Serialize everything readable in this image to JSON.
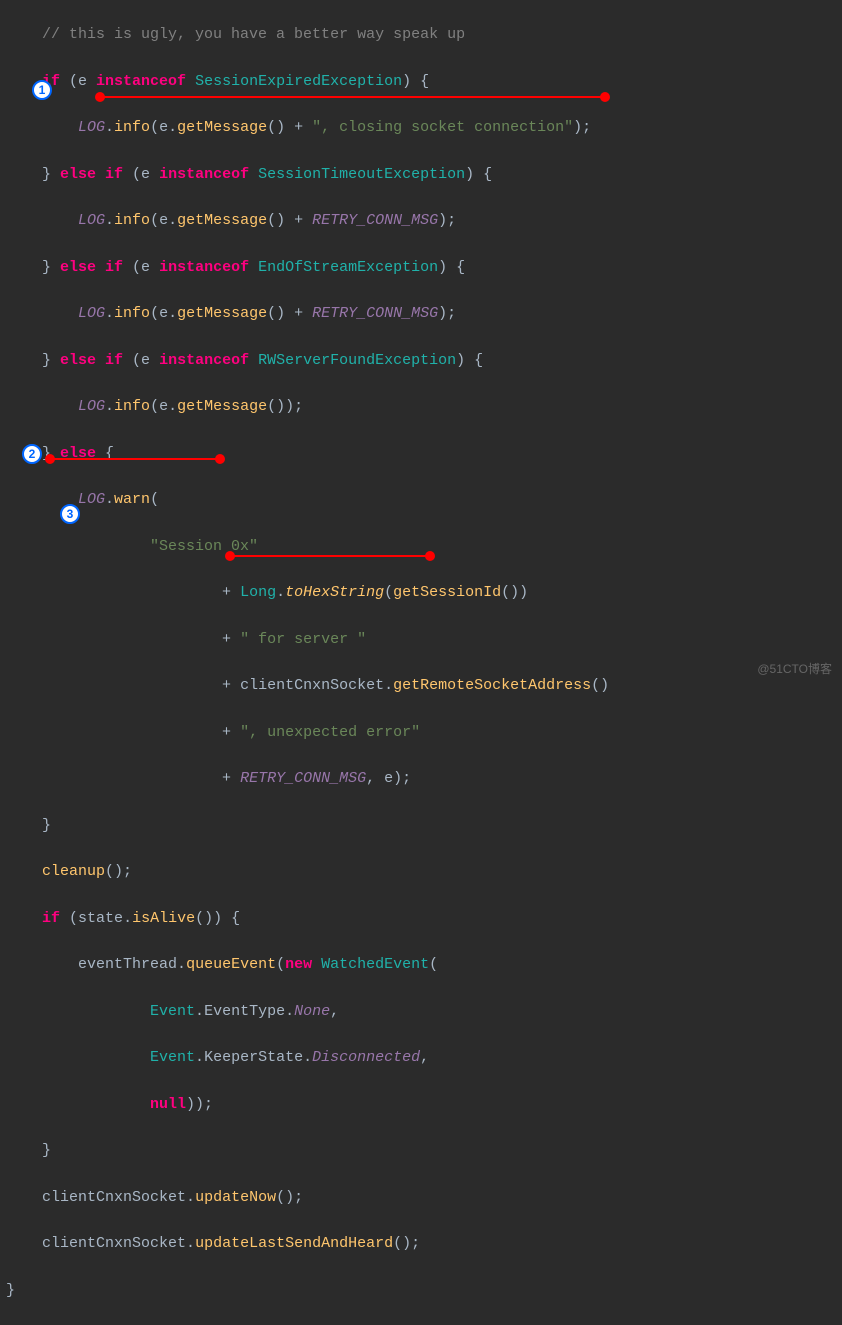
{
  "code": {
    "l0_fbrace": "} {",
    "l1_comment": "// this is ugly, you have a better way speak up",
    "l2_if": "if",
    "l2_e": " (e ",
    "l2_inst": "instanceof",
    "l2_type": " SessionExpiredException",
    "l2_end": ") {",
    "l3_log": "LOG",
    "l3_dot1": ".",
    "l3_info": "info",
    "l3_e": "(e.",
    "l3_getmsg": "getMessage",
    "l3_plus": "() + ",
    "l3_str": "\", closing socket connection\"",
    "l3_end": ");",
    "l4_brace": "} ",
    "l4_else": "else if",
    "l4_e": " (e ",
    "l4_inst": "instanceof",
    "l4_type": " SessionTimeoutException",
    "l4_end": ") {",
    "l5_log": "LOG",
    "l5_dot1": ".",
    "l5_info": "info",
    "l5_e": "(e.",
    "l5_getmsg": "getMessage",
    "l5_plus": "() + ",
    "l5_retry": "RETRY_CONN_MSG",
    "l5_end": ");",
    "l6_brace": "} ",
    "l6_else": "else if",
    "l6_e": " (e ",
    "l6_inst": "instanceof",
    "l6_type": " EndOfStreamException",
    "l6_end": ") {",
    "l7_log": "LOG",
    "l7_dot1": ".",
    "l7_info": "info",
    "l7_e": "(e.",
    "l7_getmsg": "getMessage",
    "l7_plus": "() + ",
    "l7_retry": "RETRY_CONN_MSG",
    "l7_end": ");",
    "l8_brace": "} ",
    "l8_else": "else if",
    "l8_e": " (e ",
    "l8_inst": "instanceof",
    "l8_type": " RWServerFoundException",
    "l8_end": ") {",
    "l9_log": "LOG",
    "l9_dot1": ".",
    "l9_info": "info",
    "l9_e": "(e.",
    "l9_getmsg": "getMessage",
    "l9_end": "());",
    "l10_brace": "} ",
    "l10_else": "else",
    "l10_end": " {",
    "l11_log": "LOG",
    "l11_dot": ".",
    "l11_warn": "warn",
    "l11_paren": "(",
    "l12_str": "\"Session 0x\"",
    "l13_plus": "+ ",
    "l13_long": "Long",
    "l13_dot": ".",
    "l13_hex": "toHexString",
    "l13_paren1": "(",
    "l13_getsess": "getSessionId",
    "l13_end": "())",
    "l14_plus": "+ ",
    "l14_str": "\" for server \"",
    "l15_plus": "+ ",
    "l15_var": "clientCnxnSocket",
    "l15_dot": ".",
    "l15_method": "getRemoteSocketAddress",
    "l15_end": "()",
    "l16_plus": "+ ",
    "l16_str": "\", unexpected error\"",
    "l17_plus": "+ ",
    "l17_retry": "RETRY_CONN_MSG",
    "l17_end": ", e);",
    "l18_brace": "}",
    "l19_cleanup": "cleanup",
    "l19_end": "();",
    "l20_if": "if",
    "l20_p1": " (",
    "l20_state": "state",
    "l20_dot": ".",
    "l20_isalive": "isAlive",
    "l20_end": "()) {",
    "l21_var": "eventThread",
    "l21_dot": ".",
    "l21_method": "queueEvent",
    "l21_p1": "(",
    "l21_new": "new",
    "l21_type": " WatchedEvent",
    "l21_p2": "(",
    "l22_event": "Event",
    "l22_dot1": ".",
    "l22_evtype": "EventType",
    "l22_dot2": ".",
    "l22_none": "None",
    "l22_comma": ",",
    "l23_event": "Event",
    "l23_dot1": ".",
    "l23_keeper": "KeeperState",
    "l23_dot2": ".",
    "l23_disc": "Disconnected",
    "l23_comma": ",",
    "l24_null": "null",
    "l24_end": "));",
    "l25_brace": "}",
    "l26_var": "clientCnxnSocket",
    "l26_dot": ".",
    "l26_method": "updateNow",
    "l26_end": "();",
    "l27_var": "clientCnxnSocket",
    "l27_dot": ".",
    "l27_method": "updateLastSendAndHeard",
    "l27_end": "();",
    "l28_brace": "}"
  },
  "markers": {
    "m1": "1",
    "m2": "2",
    "m3": "3"
  },
  "watermark": "@51CTO博客"
}
